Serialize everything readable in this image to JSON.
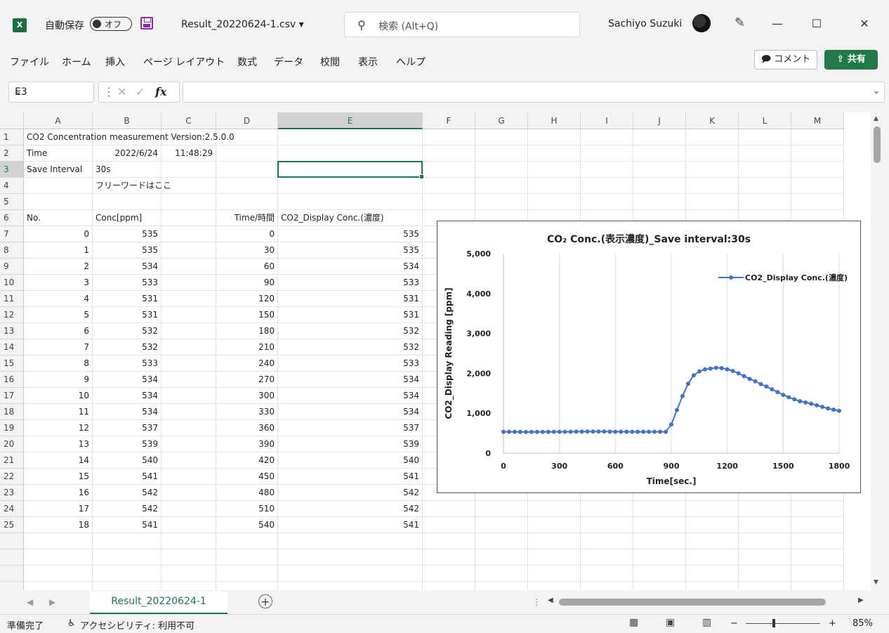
{
  "titlebar": {
    "app_logo": "X",
    "autosave_label": "自動保存",
    "autosave_state": "オフ",
    "document_title": "Result_20220624-1.csv ▾",
    "search_placeholder": "検索 (Alt+Q)",
    "user_name": "Sachiyo Suzuki",
    "minimize": "—",
    "maximize": "☐",
    "close": "✕"
  },
  "menu": {
    "items": [
      "ファイル",
      "ホーム",
      "挿入",
      "ページ レイアウト",
      "数式",
      "データ",
      "校閲",
      "表示",
      "ヘルプ"
    ],
    "comment_label": "コメント",
    "share_label": "共有"
  },
  "formula_bar": {
    "name_box": "E3",
    "formula": ""
  },
  "sheet": {
    "columns": [
      "A",
      "B",
      "C",
      "D",
      "E",
      "F",
      "G",
      "H",
      "I",
      "J",
      "K",
      "L",
      "M"
    ],
    "rows": [
      "1",
      "2",
      "3",
      "4",
      "5",
      "6",
      "7",
      "8",
      "9",
      "10",
      "11",
      "12",
      "13",
      "14",
      "15",
      "16",
      "17",
      "18",
      "19",
      "20",
      "21",
      "22",
      "23",
      "24",
      "25"
    ],
    "a1": "CO2 Concentration measurement Version:2.5.0.0",
    "a2": "Time",
    "b2": "2022/6/24",
    "c2": "11:48:29",
    "a3": "Save Interval",
    "b3": "30s",
    "b4": "フリーワードはここ",
    "a6": "No.",
    "b6": "Conc[ppm]",
    "d6": "Time/時間",
    "e6": "CO2_Display Conc.(濃度)",
    "data": [
      [
        "0",
        "535",
        "0",
        "535"
      ],
      [
        "1",
        "535",
        "30",
        "535"
      ],
      [
        "2",
        "534",
        "60",
        "534"
      ],
      [
        "3",
        "533",
        "90",
        "533"
      ],
      [
        "4",
        "531",
        "120",
        "531"
      ],
      [
        "5",
        "531",
        "150",
        "531"
      ],
      [
        "6",
        "532",
        "180",
        "532"
      ],
      [
        "7",
        "532",
        "210",
        "532"
      ],
      [
        "8",
        "533",
        "240",
        "533"
      ],
      [
        "9",
        "534",
        "270",
        "534"
      ],
      [
        "10",
        "534",
        "300",
        "534"
      ],
      [
        "11",
        "534",
        "330",
        "534"
      ],
      [
        "12",
        "537",
        "360",
        "537"
      ],
      [
        "13",
        "539",
        "390",
        "539"
      ],
      [
        "14",
        "540",
        "420",
        "540"
      ],
      [
        "15",
        "541",
        "450",
        "541"
      ],
      [
        "16",
        "542",
        "480",
        "542"
      ],
      [
        "17",
        "542",
        "510",
        "542"
      ],
      [
        "18",
        "541",
        "540",
        "541"
      ]
    ],
    "active_cell": "E3"
  },
  "chart_data": {
    "type": "line",
    "title": "CO₂ Conc.(表示濃度)_Save interval:30s",
    "xlabel": "Time[sec.]",
    "ylabel": "CO2_Display Reading [ppm]",
    "xlim": [
      0,
      1800
    ],
    "ylim": [
      0,
      5000
    ],
    "x_ticks": [
      "0",
      "300",
      "600",
      "900",
      "1200",
      "1500",
      "1800"
    ],
    "y_ticks": [
      "0",
      "1,000",
      "2,000",
      "3,000",
      "4,000",
      "5,000"
    ],
    "grid": "vertical",
    "legend_position": "top-right",
    "series": [
      {
        "name": "CO2_Display Conc.(濃度)",
        "color": "#4472c4",
        "x": [
          0,
          30,
          60,
          90,
          120,
          150,
          180,
          210,
          240,
          270,
          300,
          330,
          360,
          390,
          420,
          450,
          480,
          510,
          540,
          570,
          600,
          630,
          660,
          690,
          720,
          750,
          780,
          810,
          840,
          870,
          900,
          930,
          960,
          990,
          1020,
          1050,
          1080,
          1110,
          1140,
          1170,
          1200,
          1230,
          1260,
          1290,
          1320,
          1350,
          1380,
          1410,
          1440,
          1470,
          1500,
          1530,
          1560,
          1590,
          1620,
          1650,
          1680,
          1710,
          1740,
          1770,
          1800
        ],
        "values": [
          535,
          535,
          534,
          533,
          531,
          531,
          532,
          532,
          533,
          534,
          534,
          534,
          537,
          539,
          540,
          541,
          542,
          542,
          541,
          540,
          538,
          537,
          536,
          535,
          535,
          534,
          534,
          534,
          534,
          535,
          720,
          1080,
          1430,
          1740,
          1950,
          2050,
          2100,
          2120,
          2140,
          2130,
          2100,
          2060,
          2000,
          1930,
          1860,
          1800,
          1730,
          1670,
          1600,
          1530,
          1460,
          1400,
          1350,
          1300,
          1270,
          1240,
          1200,
          1160,
          1120,
          1090,
          1060
        ]
      }
    ]
  },
  "tabs": {
    "sheet_name": "Result_20220624-1",
    "add_sheet": "+"
  },
  "status": {
    "ready": "準備完了",
    "accessibility": "アクセシビリティ: 利用不可",
    "zoom_minus": "−",
    "zoom_plus": "+",
    "zoom_level": "85%"
  }
}
